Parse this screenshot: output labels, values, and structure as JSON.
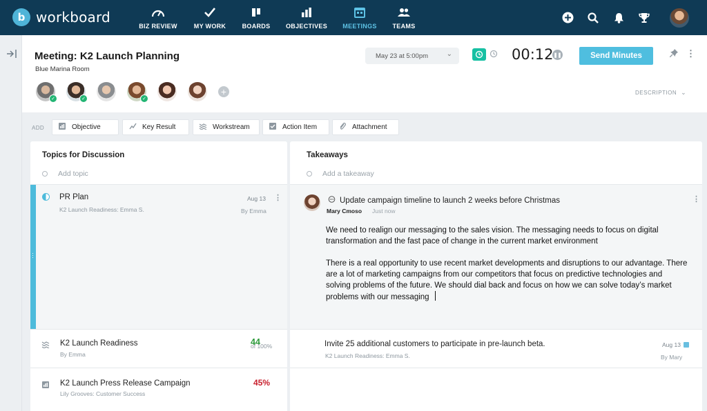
{
  "app": {
    "logo_letter": "b",
    "name": "workboard"
  },
  "nav": {
    "items": [
      {
        "label": "BIZ REVIEW",
        "icon": "gauge-icon"
      },
      {
        "label": "MY WORK",
        "icon": "check-icon"
      },
      {
        "label": "BOARDS",
        "icon": "boards-icon"
      },
      {
        "label": "OBJECTIVES",
        "icon": "bar-chart-icon"
      },
      {
        "label": "MEETINGS",
        "icon": "calendar-icon",
        "active": true
      },
      {
        "label": "TEAMS",
        "icon": "people-icon"
      }
    ],
    "right_icons": [
      "add-circle-icon",
      "search-icon",
      "bell-icon",
      "trophy-icon",
      "user-avatar"
    ]
  },
  "header": {
    "title": "Meeting: K2 Launch Planning",
    "room": "Blue Marina Room",
    "date": "May 23 at 5:00pm",
    "timer": "00:12",
    "send_label": "Send Minutes",
    "description_label": "DESCRIPTION",
    "attendees": [
      {
        "checked": true
      },
      {
        "checked": true
      },
      {
        "checked": false
      },
      {
        "checked": true
      },
      {
        "checked": false
      },
      {
        "checked": false
      }
    ]
  },
  "add_bar": {
    "label": "ADD",
    "buttons": [
      {
        "label": "Objective",
        "icon": "objective-icon"
      },
      {
        "label": "Key Result",
        "icon": "key-result-icon"
      },
      {
        "label": "Workstream",
        "icon": "workstream-icon"
      },
      {
        "label": "Action Item",
        "icon": "checkbox-icon"
      },
      {
        "label": "Attachment",
        "icon": "paperclip-icon"
      }
    ]
  },
  "topics": {
    "title": "Topics for Discussion",
    "add_placeholder": "Add topic",
    "items": [
      {
        "title": "PR Plan",
        "subtitle": "K2 Launch Readiness: Emma S.",
        "date": "Aug 13",
        "by": "By Emma"
      },
      {
        "title": "K2 Launch Readiness",
        "subtitle": "By Emma",
        "progress": "44",
        "progress_of": "of 100%"
      },
      {
        "title": "K2 Launch Press Release Campaign",
        "subtitle": "Lily Grooves: Customer Success",
        "progress": "45%"
      }
    ]
  },
  "takeaways": {
    "title": "Takeaways",
    "add_placeholder": "Add a takeaway",
    "selected": {
      "title": "Update campaign timeline to launch 2 weeks before Christmas",
      "author": "Mary Cmoso",
      "time": "Just now",
      "paragraph1": "We need to realign our messaging to the sales vision. The messaging needs to focus on digital transformation and the fast pace of change in the current market environment",
      "paragraph2": "There is a real opportunity to use recent market developments and disruptions to our advantage. There are a lot of marketing campaigns from our competitors that focus on predictive technologies and solving problems of the future. We should dial back and focus on how we can solve today’s market problems with our messaging"
    },
    "items": [
      {
        "title": "Invite 25 additional customers to participate in pre-launch beta.",
        "subtitle": "K2 Launch Readiness: Emma S.",
        "date": "Aug 13",
        "by": "By Mary"
      }
    ]
  },
  "colors": {
    "nav_bg": "#0f3a55",
    "accent": "#4fbedf",
    "green": "#2d9a3a",
    "red": "#c8202e"
  }
}
